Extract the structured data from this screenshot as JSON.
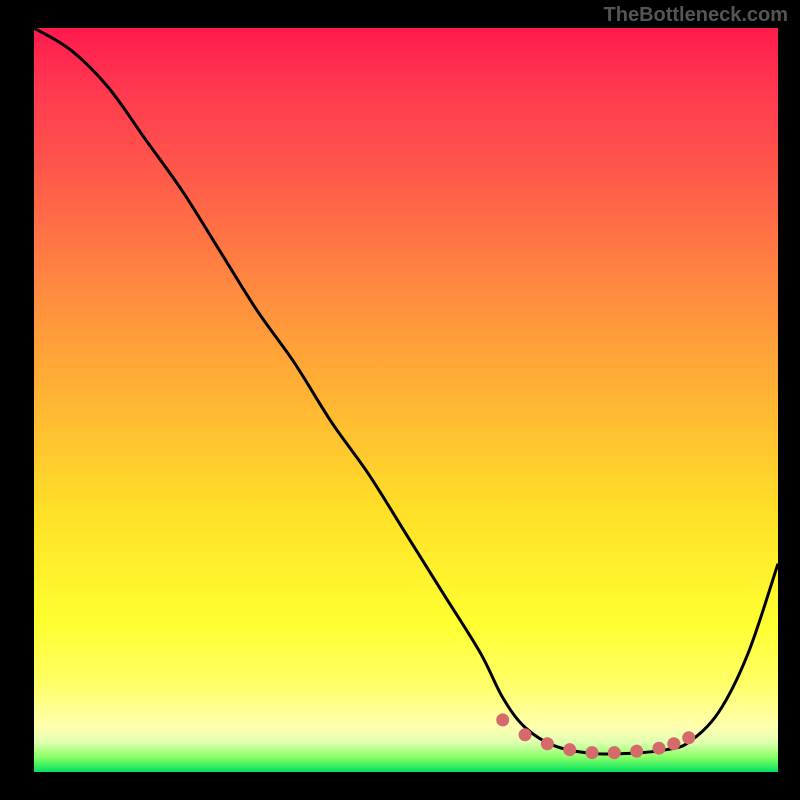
{
  "watermark": "TheBottleneck.com",
  "chart_data": {
    "type": "line",
    "title": "",
    "xlabel": "",
    "ylabel": "",
    "xlim": [
      0,
      100
    ],
    "ylim": [
      0,
      100
    ],
    "background": {
      "type": "vertical-gradient",
      "stops": [
        {
          "pos": 0,
          "color": "#ff1a4d"
        },
        {
          "pos": 50,
          "color": "#ffb533"
        },
        {
          "pos": 90,
          "color": "#ffff66"
        },
        {
          "pos": 100,
          "color": "#00e060"
        }
      ]
    },
    "series": [
      {
        "name": "bottleneck-curve",
        "color": "#000000",
        "x": [
          0,
          5,
          10,
          15,
          20,
          25,
          30,
          35,
          40,
          45,
          50,
          55,
          60,
          63,
          66,
          70,
          75,
          80,
          85,
          88,
          92,
          96,
          100
        ],
        "y": [
          100,
          97,
          92,
          85,
          78,
          70,
          62,
          55,
          47,
          40,
          32,
          24,
          16,
          10,
          6,
          3.5,
          2.5,
          2.5,
          3,
          4,
          8,
          16,
          28
        ]
      },
      {
        "name": "highlight-dots",
        "type": "scatter",
        "color": "#d46a6a",
        "x": [
          63,
          66,
          69,
          72,
          75,
          78,
          81,
          84,
          86,
          88
        ],
        "y": [
          7,
          5,
          3.8,
          3,
          2.6,
          2.6,
          2.8,
          3.2,
          3.8,
          4.6
        ]
      }
    ]
  }
}
